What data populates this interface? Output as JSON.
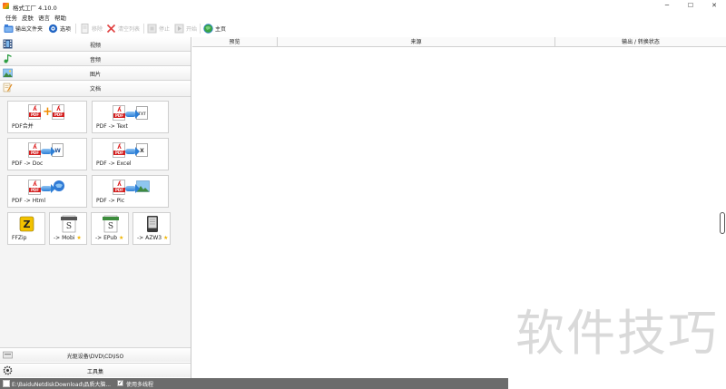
{
  "window": {
    "title": "格式工厂 4.10.0",
    "controls": {
      "minimize": "─",
      "maximize": "☐",
      "close": "✕"
    }
  },
  "menu": [
    "任务",
    "皮肤",
    "语言",
    "帮助"
  ],
  "toolbar": {
    "output_folder": "输出文件夹",
    "options": "选项",
    "remove": "移除",
    "clear_list": "清空列表",
    "stop": "停止",
    "start": "开始",
    "homepage": "主页"
  },
  "categories": {
    "video": "视频",
    "audio": "音频",
    "image": "图片",
    "document": "文档"
  },
  "tools": [
    {
      "label": "PDF合并",
      "icon": "pdf-merge-icon"
    },
    {
      "label": "PDF -> Text",
      "icon": "pdf-to-text-icon"
    },
    {
      "label": "PDF -> Doc",
      "icon": "pdf-to-doc-icon"
    },
    {
      "label": "PDF -> Excel",
      "icon": "pdf-to-excel-icon"
    },
    {
      "label": "PDF -> Html",
      "icon": "pdf-to-html-icon"
    },
    {
      "label": "PDF -> Pic",
      "icon": "pdf-to-pic-icon"
    },
    {
      "label": "FFZip",
      "icon": "ffzip-icon"
    },
    {
      "label": "-> Mobi",
      "icon": "mobi-icon"
    },
    {
      "label": "-> EPub",
      "icon": "epub-icon"
    },
    {
      "label": "-> AZW3",
      "icon": "azw3-icon"
    }
  ],
  "pdf_tag": "PDF",
  "bottom_categories": {
    "optical": "光驱设备\\DVD\\CD\\ISO",
    "toolbox": "工具集"
  },
  "task_columns": [
    "预览",
    "来源",
    "输出 / 转换状态"
  ],
  "status": {
    "output_path": "E:\\BaiduNetdiskDownload\\品质大脑...",
    "multithread_label": "使用多线程",
    "multithread_checked": true
  },
  "watermark": "软件技巧",
  "colors": {
    "status_bar": "#6c6c6c",
    "accent_blue": "#2d7fd6",
    "pdf_red": "#d42020",
    "star": "#f0b400"
  }
}
